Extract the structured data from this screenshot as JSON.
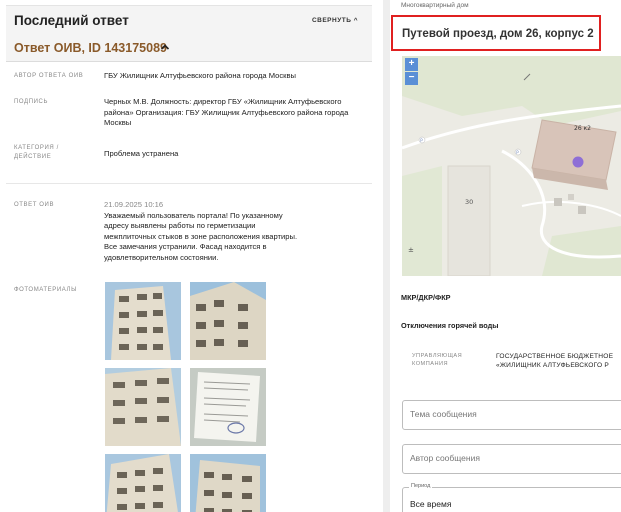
{
  "last_answer": {
    "title": "Последний ответ",
    "collapse_label": "СВЕРНУТЬ ^",
    "oiv_title": "Ответ ОИВ, ID 143175089",
    "rows": [
      {
        "label": "АВТОР ОТВЕТА ОИВ",
        "value": "ГБУ Жилищник Алтуфьевского района города Москвы"
      },
      {
        "label": "ПОДПИСЬ",
        "value": "Черных М.В. Должность: директор ГБУ «Жилищник Алтуфьевского района» Организация: ГБУ Жилищник Алтуфьевского района города Москвы"
      },
      {
        "label": "КАТЕГОРИЯ / ДЕЙСТВИЕ",
        "value": "Проблема устранена"
      }
    ],
    "answer_label": "ОТВЕТ ОИВ",
    "answer_date": "21.09.2025 10:16",
    "answer_text": "Уважаемый пользователь портала! По указанному адресу выявлены работы по герметизации межплиточных стыков в зоне расположения квартиры. Все замечания устранили. Фасад находится в удовлетворительном состоянии.",
    "photos_label": "ФОТОМАТЕРИАЛЫ"
  },
  "building": {
    "type_label": "Многоквартирный дом",
    "address": "Путевой проезд, дом 26, корпус 2",
    "map": {
      "zoom_in": "+",
      "zoom_out": "−",
      "house_label": "26 к2",
      "number_30": "30",
      "p_marker": "P"
    },
    "mkr_label": "МКР/ДКР/ФКР",
    "hot_water_label": "Отключения горячей воды",
    "uk_label": "УПРАВЛЯЮЩАЯ КОМПАНИЯ",
    "uk_value_line1": "ГОСУДАРСТВЕННОЕ БЮДЖЕТНОЕ",
    "uk_value_line2": "«ЖИЛИЩНИК АЛТУФЬЕВСКОГО Р"
  },
  "form": {
    "subject_placeholder": "Тема сообщения",
    "author_placeholder": "Автор сообщения",
    "period_legend": "Период",
    "period_value": "Все время"
  },
  "colors": {
    "accent_red": "#e02020",
    "oiv_title": "#8a5a2a",
    "zoom": "#5a8fd6"
  }
}
